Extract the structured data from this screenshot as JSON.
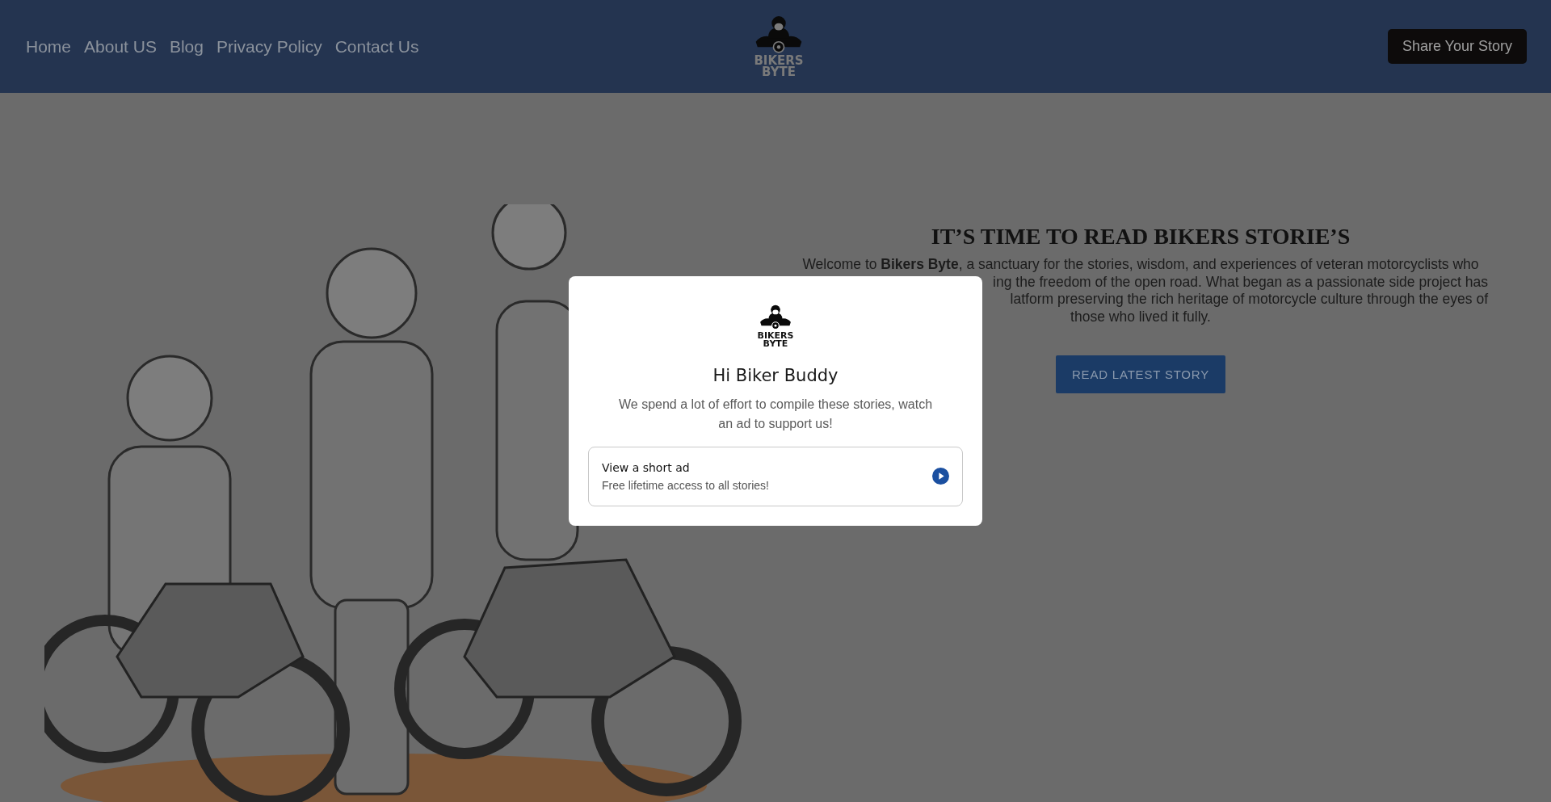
{
  "header": {
    "nav": [
      "Home",
      "About US",
      "Blog",
      "Privacy Policy",
      "Contact Us"
    ],
    "logo": {
      "lines": [
        "BIKERS",
        "BYTE"
      ]
    },
    "cta": "Share Your Story"
  },
  "hero": {
    "title": "IT’S TIME TO READ BIKERS STORIE’S",
    "paragraph_lines": [
      {
        "text": "Welcome to **Bikers Byte**, a sanctuary for the stories, wisdom, and experiences of veteran motorcyclists who"
      },
      {
        "text": "ing the freedom of the open road. What began as a passionate side project has"
      },
      {
        "text": "latform preserving the rich heritage of motorcycle culture through the eyes of"
      },
      {
        "text": "those who lived it fully."
      }
    ],
    "button": "READ LATEST STORY"
  },
  "modal": {
    "logo": {
      "lines": [
        "BIKERS",
        "BYTE"
      ]
    },
    "title": "Hi Biker Buddy",
    "message": "We spend a lot of effort to compile these stories, watch an ad to support us!",
    "option": {
      "title": "View a short ad",
      "subtitle": "Free lifetime access to all stories!"
    }
  }
}
